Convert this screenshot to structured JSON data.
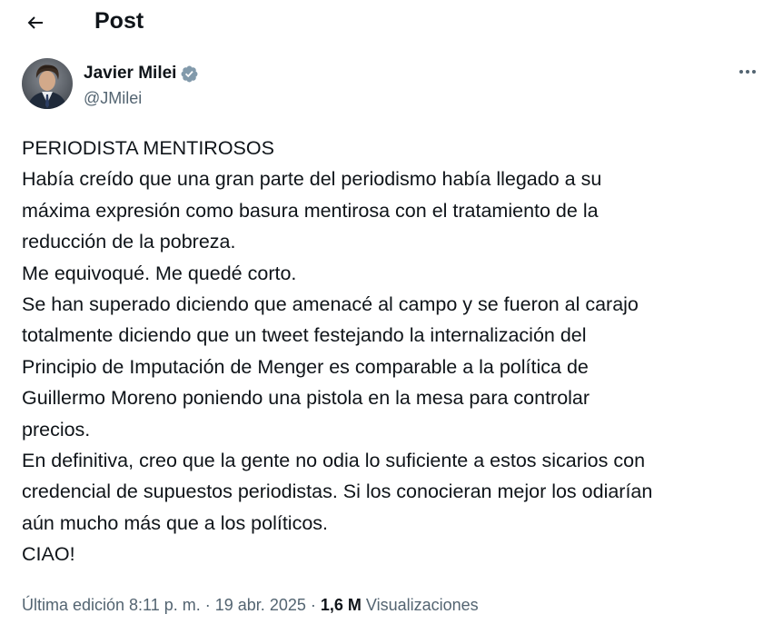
{
  "header": {
    "title": "Post"
  },
  "author": {
    "display_name": "Javier Milei",
    "handle": "@JMilei",
    "verified_color": "#829aab"
  },
  "tweet": {
    "lines": [
      "PERIODISTA MENTIROSOS",
      "Había creído que una gran parte del periodismo había llegado a su",
      "máxima expresión como basura mentirosa con el tratamiento de la",
      "reducción de la pobreza.",
      "Me equivoqué. Me quedé corto.",
      "Se han superado diciendo que amenacé al campo y se fueron al carajo",
      "totalmente diciendo que un tweet festejando la internalización del",
      "Principio de Imputación de Menger es comparable a la política de",
      "Guillermo Moreno poniendo una pistola en la mesa para controlar",
      "precios.",
      "En definitiva, creo que la gente no odia lo suficiente a estos sicarios con",
      "credencial de supuestos periodistas. Si los conocieran mejor los odiarían",
      "aún mucho más que a los políticos.",
      "CIAO!"
    ]
  },
  "meta": {
    "edited_label": "Última edición 8:11 p. m.",
    "separator": " · ",
    "date": "19 abr. 2025",
    "views_count": "1,6 M",
    "views_label": " Visualizaciones"
  },
  "colors": {
    "text": "#0f1419",
    "secondary": "#536471"
  }
}
